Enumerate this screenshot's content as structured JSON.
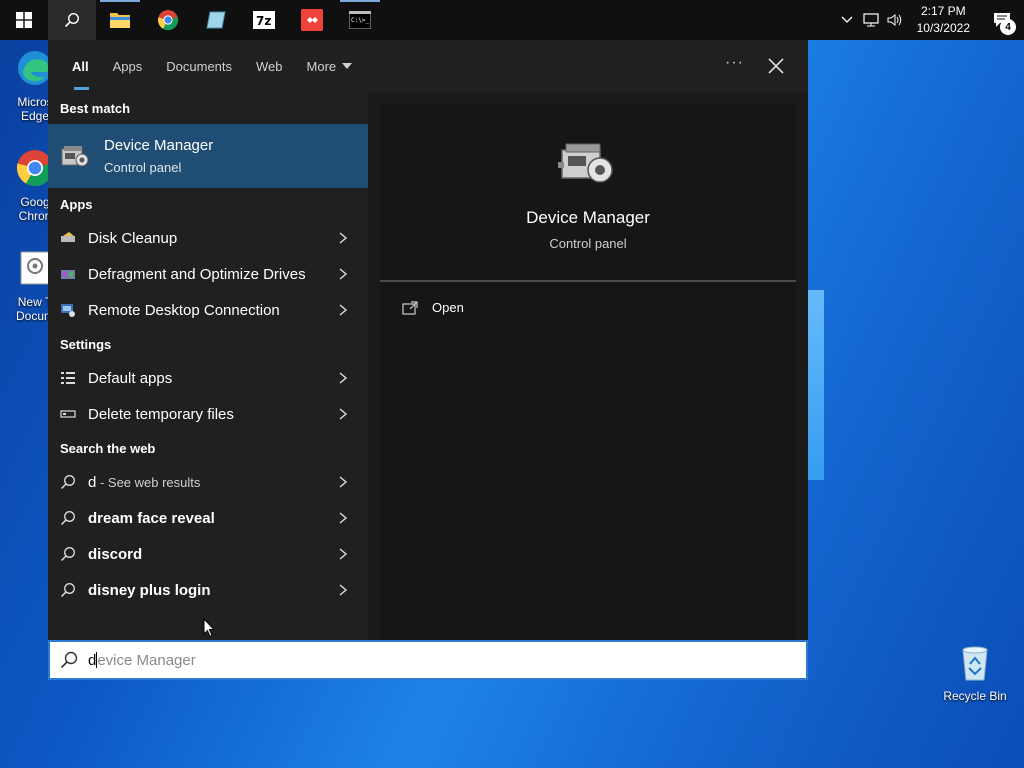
{
  "taskbar": {
    "clock_time": "2:17 PM",
    "clock_date": "10/3/2022",
    "notification_count": "4",
    "pinned_apps": [
      "start-icon",
      "search-icon",
      "file-explorer-icon",
      "chrome-icon",
      "notepad-icon",
      "7zip-icon",
      "anydesk-icon",
      "terminal-icon"
    ]
  },
  "desktop": {
    "icons": [
      {
        "label": "Micros Edge",
        "icon": "edge-icon"
      },
      {
        "label": "Goog Chron",
        "icon": "chrome-icon"
      },
      {
        "label": "New T Docum",
        "icon": "document-icon"
      },
      {
        "label": "Recycle Bin",
        "icon": "recycle-bin-icon"
      }
    ]
  },
  "search": {
    "tabs": [
      {
        "label": "All"
      },
      {
        "label": "Apps"
      },
      {
        "label": "Documents"
      },
      {
        "label": "Web"
      },
      {
        "label": "More"
      }
    ],
    "sections": {
      "best_match": "Best match",
      "apps": "Apps",
      "settings": "Settings",
      "web": "Search the web"
    },
    "best_match": {
      "title": "Device Manager",
      "subtitle": "Control panel"
    },
    "apps": [
      {
        "label": "Disk Cleanup",
        "icon": "disk-cleanup-icon"
      },
      {
        "label": "Defragment and Optimize Drives",
        "icon": "defrag-icon"
      },
      {
        "label": "Remote Desktop Connection",
        "icon": "remote-desktop-icon"
      }
    ],
    "settings": [
      {
        "label": "Default apps",
        "icon": "list-icon"
      },
      {
        "label": "Delete temporary files",
        "icon": "drive-icon"
      }
    ],
    "web_results": [
      {
        "label": "d",
        "suffix": " - See web results"
      },
      {
        "label": "dream face reveal"
      },
      {
        "label": "discord"
      },
      {
        "label": "disney plus login"
      }
    ],
    "detail": {
      "title": "Device Manager",
      "subtitle": "Control panel",
      "action_open": "Open"
    },
    "query": {
      "typed": "d",
      "autocomplete": "evice Manager"
    }
  }
}
